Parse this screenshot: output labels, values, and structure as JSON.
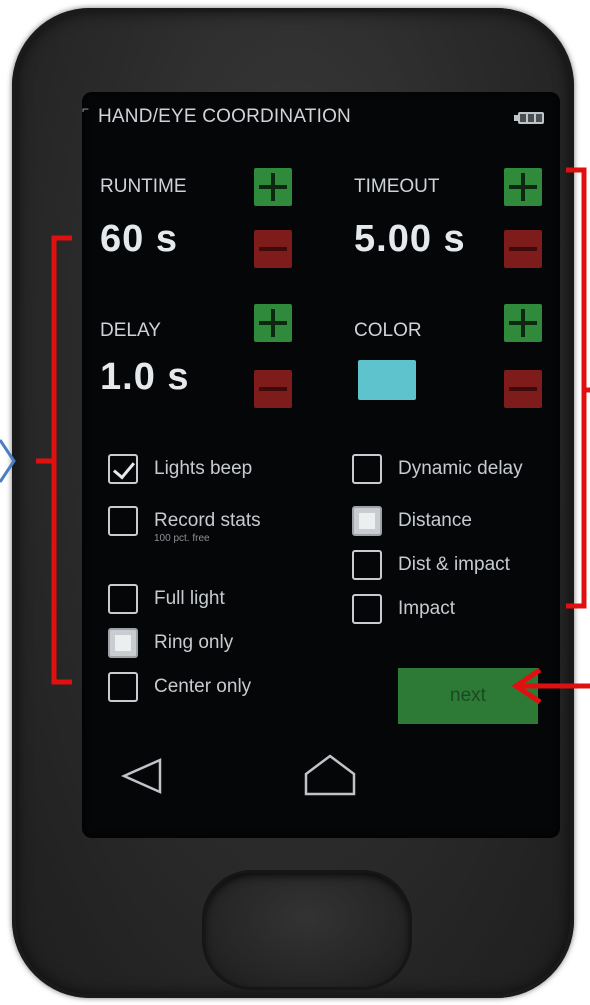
{
  "header": {
    "title": "HAND/EYE COORDINATION",
    "battery_icon": "battery-icon"
  },
  "runtime": {
    "label": "RUNTIME",
    "value": "60 s"
  },
  "timeout": {
    "label": "TIMEOUT",
    "value": "5.00 s"
  },
  "delay": {
    "label": "DELAY",
    "value": "1.0 s"
  },
  "color": {
    "label": "COLOR",
    "swatch": "#5ec3cc"
  },
  "options_left": [
    {
      "label": "Lights beep",
      "sub": "",
      "state": "checked"
    },
    {
      "label": "Record stats",
      "sub": "100 pct. free",
      "state": "unchecked"
    },
    {
      "label": "Full light",
      "sub": "",
      "state": "unchecked"
    },
    {
      "label": "Ring only",
      "sub": "",
      "state": "selected"
    },
    {
      "label": "Center only",
      "sub": "",
      "state": "unchecked"
    }
  ],
  "options_right": [
    {
      "label": "Dynamic delay",
      "state": "unchecked"
    },
    {
      "label": "Distance",
      "state": "selected"
    },
    {
      "label": "Dist & impact",
      "state": "unchecked"
    },
    {
      "label": "Impact",
      "state": "unchecked"
    }
  ],
  "next_button": {
    "label": "next"
  },
  "nav": {
    "back_icon": "back-triangle-icon",
    "home_icon": "home-icon"
  },
  "colors": {
    "plus_button": "#2f8a3b",
    "minus_button": "#7e1c1c",
    "next_button": "#2c7a36",
    "annotation_red": "#e01010",
    "annotation_blue": "#4a7fc1"
  }
}
